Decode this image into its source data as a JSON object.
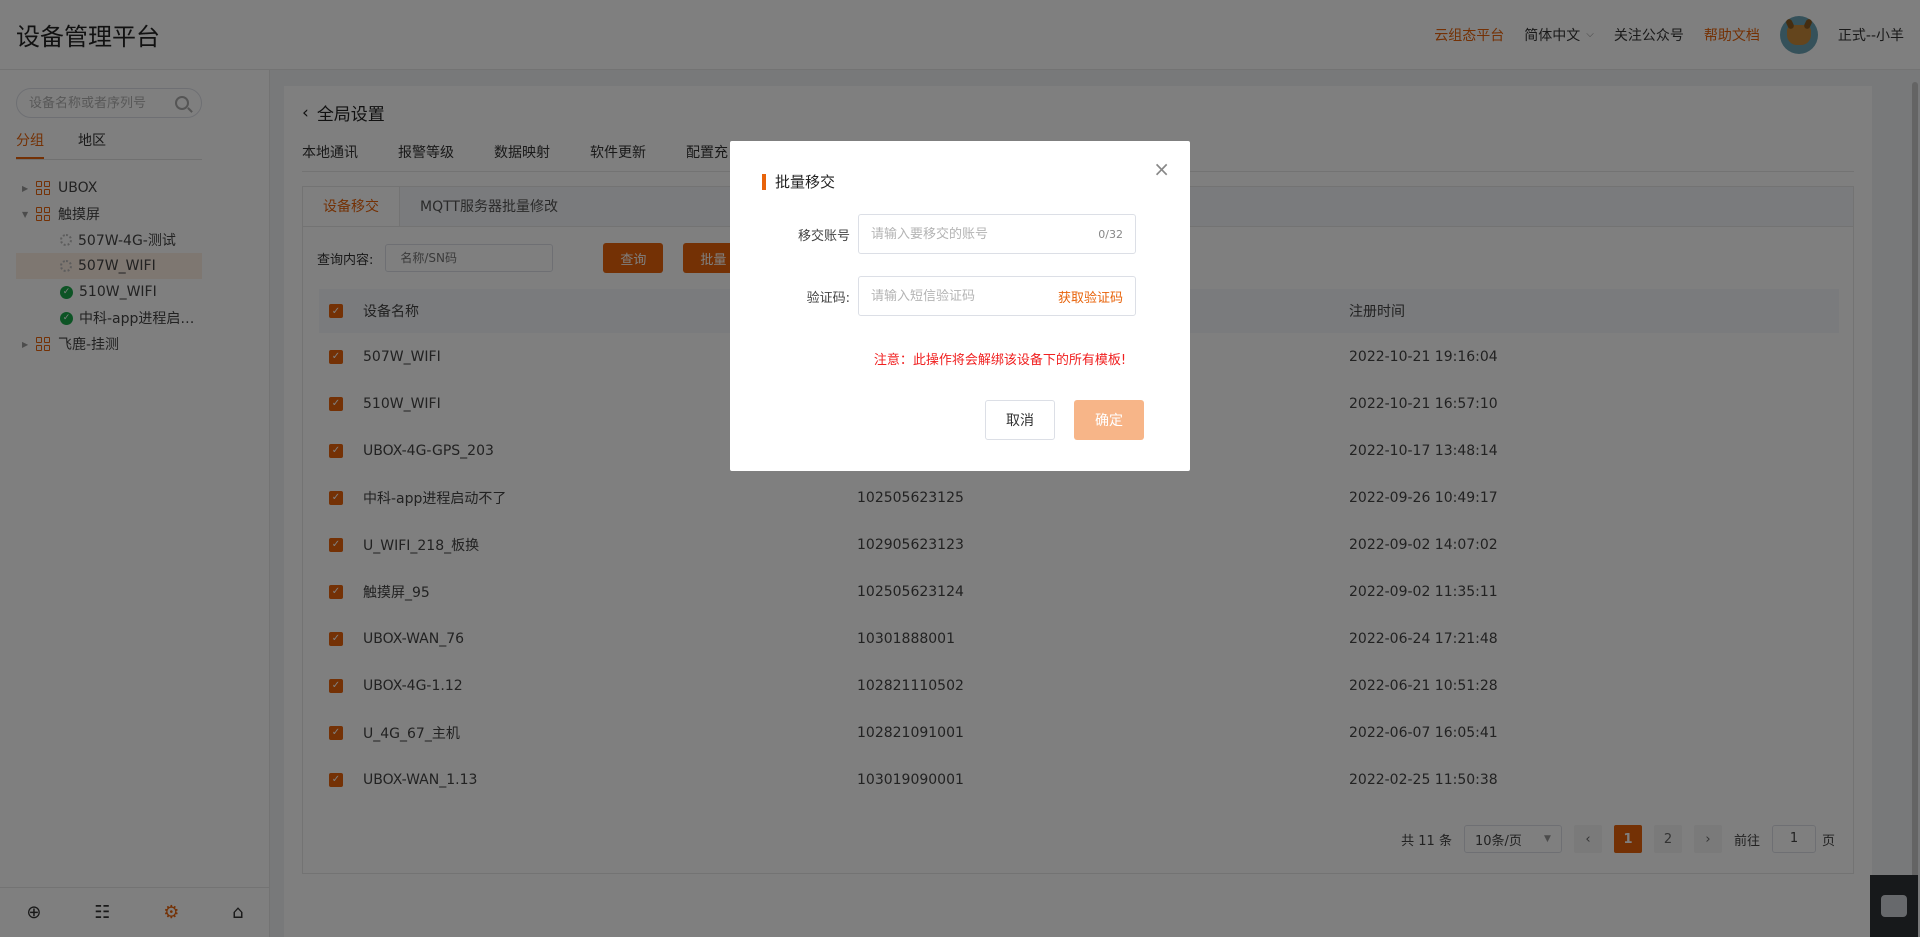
{
  "header": {
    "title": "设备管理平台",
    "cloud_platform": "云组态平台",
    "language": "简体中文",
    "follow": "关注公众号",
    "help": "帮助文档",
    "user": "正式--小羊"
  },
  "sidebar": {
    "search_placeholder": "设备名称或者序列号",
    "tabs": [
      "分组",
      "地区"
    ],
    "tree": [
      {
        "label": "UBOX",
        "type": "group",
        "level": 0
      },
      {
        "label": "触摸屏",
        "type": "group",
        "level": 0,
        "expanded": true
      },
      {
        "label": "507W-4G-测试",
        "type": "offline",
        "level": 1
      },
      {
        "label": "507W_WIFI",
        "type": "offline",
        "level": 1,
        "selected": true
      },
      {
        "label": "510W_WIFI",
        "type": "online",
        "level": 1
      },
      {
        "label": "中科-app进程启…",
        "type": "online",
        "level": 1
      },
      {
        "label": "飞鹿-挂测",
        "type": "group",
        "level": 0
      }
    ]
  },
  "main": {
    "back_title": "全局设置",
    "tabs": [
      "本地通讯",
      "报警等级",
      "数据映射",
      "软件更新",
      "配置充"
    ],
    "panel_tabs": [
      "设备移交",
      "MQTT服务器批量修改"
    ],
    "query_label": "查询内容:",
    "query_placeholder": "名称/SN码",
    "query_btn": "查询",
    "batch_btn": "批量",
    "table": {
      "headers": {
        "name": "设备名称",
        "sn": "",
        "time": "注册时间"
      },
      "rows": [
        {
          "name": "507W_WIFI",
          "sn": "",
          "time": "2022-10-21 19:16:04"
        },
        {
          "name": "510W_WIFI",
          "sn": "",
          "time": "2022-10-21 16:57:10"
        },
        {
          "name": "UBOX-4G-GPS_203",
          "sn": "",
          "time": "2022-10-17 13:48:14"
        },
        {
          "name": "中科-app进程启动不了",
          "sn": "102505623125",
          "time": "2022-09-26 10:49:17"
        },
        {
          "name": "U_WIFI_218_板换",
          "sn": "102905623123",
          "time": "2022-09-02 14:07:02"
        },
        {
          "name": "触摸屏_95",
          "sn": "102505623124",
          "time": "2022-09-02 11:35:11"
        },
        {
          "name": "UBOX-WAN_76",
          "sn": "10301888001",
          "time": "2022-06-24 17:21:48"
        },
        {
          "name": "UBOX-4G-1.12",
          "sn": "102821110502",
          "time": "2022-06-21 10:51:28"
        },
        {
          "name": "U_4G_67_主机",
          "sn": "102821091001",
          "time": "2022-06-07 16:05:41"
        },
        {
          "name": "UBOX-WAN_1.13",
          "sn": "103019090001",
          "time": "2022-02-25 11:50:38"
        }
      ]
    },
    "pager": {
      "total": "共 11 条",
      "page_size": "10条/页",
      "pages": [
        "1",
        "2"
      ],
      "goto_label": "前往",
      "goto_value": "1",
      "page_unit": "页"
    }
  },
  "modal": {
    "title": "批量移交",
    "account_label": "移交账号",
    "account_placeholder": "请输入要移交的账号",
    "account_count": "0/32",
    "code_label": "验证码:",
    "code_placeholder": "请输入短信验证码",
    "get_code": "获取验证码",
    "warning": "注意：此操作将会解绑该设备下的所有模板!",
    "cancel": "取消",
    "confirm": "确定"
  },
  "colors": {
    "accent": "#e8630a",
    "online": "#1aa84b",
    "warning": "#f02020"
  }
}
